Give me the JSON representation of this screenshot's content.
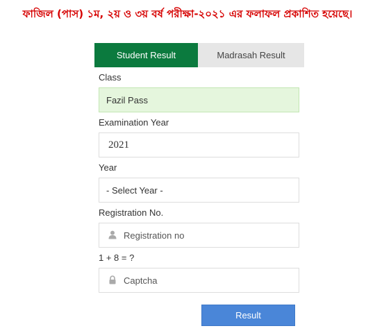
{
  "notice": "ফাজিল (পাস) ১ম, ২য় ও ৩য় বর্ষ পরীক্ষা-২০২১ এর ফলাফল প্রকাশিত হয়েছে।",
  "tabs": {
    "student": "Student Result",
    "madrasah": "Madrasah Result"
  },
  "form": {
    "class_label": "Class",
    "class_value": "Fazil Pass",
    "exam_year_label": "Examination Year",
    "exam_year_value": "2021",
    "year_label": "Year",
    "year_value": "- Select Year -",
    "reg_label": "Registration No.",
    "reg_placeholder": "Registration no",
    "captcha_label": "1 + 8 = ?",
    "captcha_placeholder": "Captcha",
    "submit_label": "Result"
  },
  "colors": {
    "notice": "#d60000",
    "tab_active": "#0b7a3e",
    "tab_inactive": "#e6e6e6",
    "class_field": "#e5f6dd",
    "button": "#4a86d8"
  },
  "icons": {
    "registration": "user-icon",
    "captcha": "lock-icon"
  }
}
